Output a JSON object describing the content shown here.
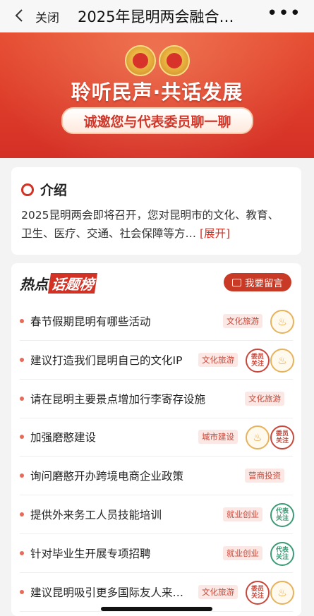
{
  "topbar": {
    "close_label": "关闭",
    "title": "2025年昆明两会融合…",
    "more_label": "•••"
  },
  "banner": {
    "slogan": "聆听民声·共话发展",
    "invite": "诚邀您与代表委员聊一聊"
  },
  "intro": {
    "title": "介绍",
    "text": "2025昆明两会即将召开，您对昆明市的文化、教育、卫生、医疗、交通、社会保障等方…",
    "expand_label": "[展开]"
  },
  "hot": {
    "logo_a": "热点",
    "logo_b": "话题榜",
    "message_button": "我要留言",
    "items": [
      {
        "text": "春节假期昆明有哪些活动",
        "tag": "文化旅游",
        "badges": [
          "fire"
        ]
      },
      {
        "text": "建议打造我们昆明自己的文化IP",
        "tag": "文化旅游",
        "badges": [
          "weiyuan",
          "fire"
        ]
      },
      {
        "text": "请在昆明主要景点增加行李寄存设施",
        "tag": "文化旅游",
        "badges": []
      },
      {
        "text": "加强磨憨建设",
        "tag": "城市建设",
        "badges": [
          "fire",
          "weiyuan"
        ]
      },
      {
        "text": "询问磨憨开办跨境电商企业政策",
        "tag": "营商投资",
        "badges": []
      },
      {
        "text": "提供外来务工人员技能培训",
        "tag": "就业创业",
        "badges": [
          "daibiao"
        ]
      },
      {
        "text": "针对毕业生开展专项招聘",
        "tag": "就业创业",
        "badges": [
          "daibiao"
        ]
      },
      {
        "text": "建议昆明吸引更多国际友人来…",
        "tag": "文化旅游",
        "badges": [
          "weiyuan",
          "fire"
        ]
      }
    ],
    "badge_text": {
      "weiyuan": "委员\n关注",
      "daibiao": "代表\n关注",
      "fire": "♨"
    }
  },
  "colors": {
    "accent": "#d33124",
    "tag_bg": "#fbe8e4",
    "daibiao": "#3c9a75"
  }
}
